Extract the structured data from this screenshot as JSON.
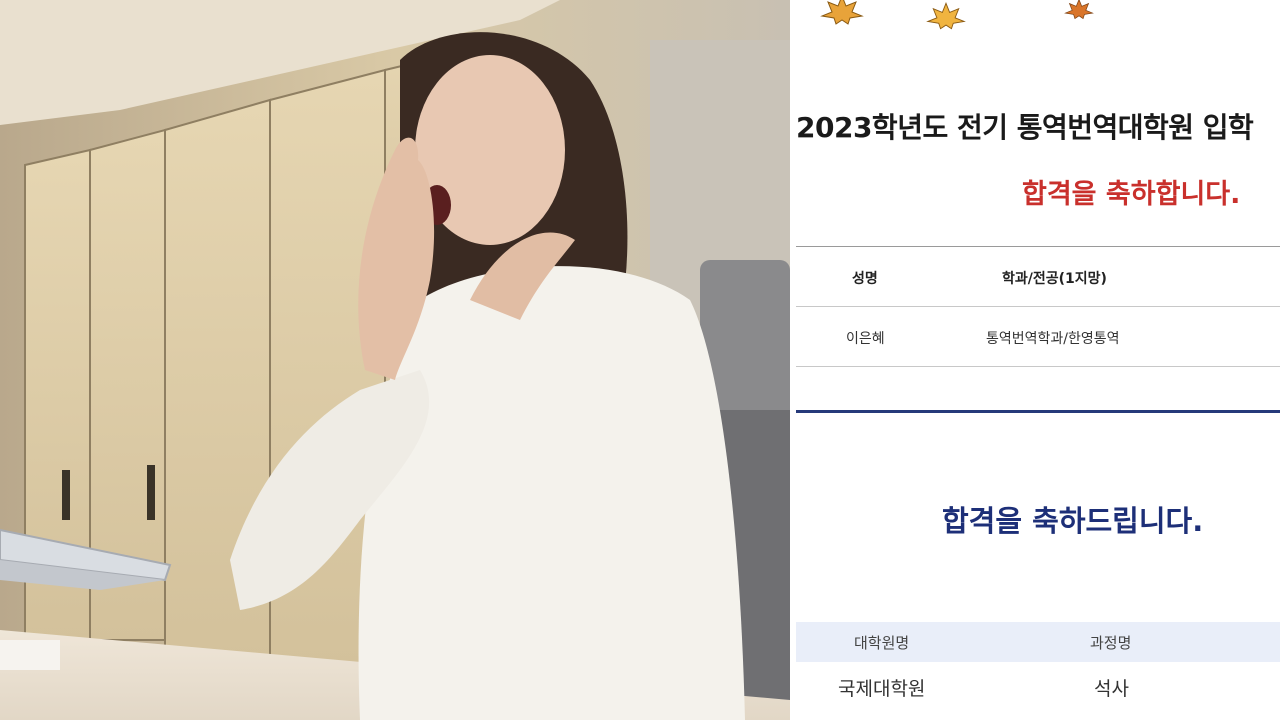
{
  "notice": {
    "title": "2023학년도 전기 통역번역대학원 입학",
    "congrats_red": "합격을 축하합니다.",
    "table": {
      "headers": [
        "성명",
        "학과/전공(1지망)"
      ],
      "row": [
        "이은혜",
        "통역번역학과/한영통역"
      ]
    },
    "congrats_blue": "합격을 축하드립니다.",
    "table2": {
      "headers": [
        "대학원명",
        "과정명"
      ],
      "row": [
        "국제대학원",
        "석사"
      ]
    }
  },
  "colors": {
    "red_text": "#c9302c",
    "blue_text": "#1d2f78",
    "separator": "#263a7a",
    "table2_header_bg": "#e9eef9",
    "leaf": "#e8a33a"
  }
}
